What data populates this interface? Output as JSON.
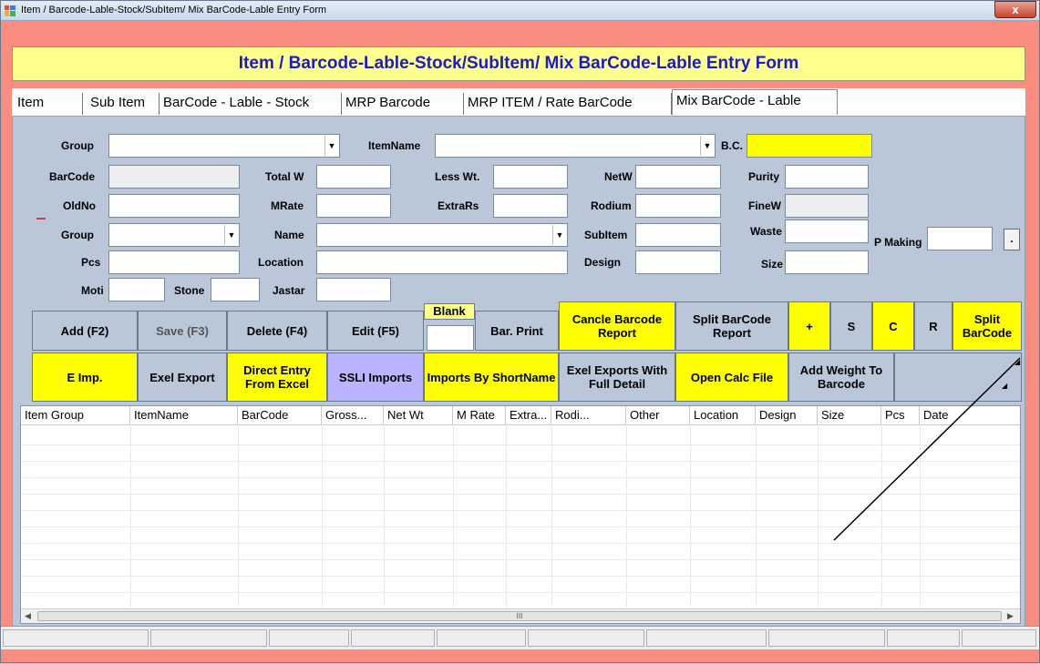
{
  "window": {
    "title": "Item / Barcode-Lable-Stock/SubItem/ Mix BarCode-Lable Entry Form",
    "close_label": "x"
  },
  "header": {
    "title": "Item / Barcode-Lable-Stock/SubItem/ Mix BarCode-Lable Entry Form"
  },
  "tabs": [
    "Item",
    "Sub Item",
    "BarCode - Lable - Stock",
    "MRP Barcode",
    "MRP ITEM / Rate BarCode",
    "Mix BarCode - Lable"
  ],
  "form": {
    "group": "Group",
    "itemname": "ItemName",
    "bc": "B.C.",
    "barcode": "BarCode",
    "total_w": "Total W",
    "less_wt": "Less Wt.",
    "netw": "NetW",
    "purity": "Purity",
    "oldno": "OldNo",
    "mrate": "MRate",
    "extrars": "ExtraRs",
    "rodium": "Rodium",
    "finew": "FineW",
    "group2": "Group",
    "name": "Name",
    "subitem": "SubItem",
    "waste": "Waste",
    "p_making": "P Making",
    "pcs": "Pcs",
    "location": "Location",
    "design": "Design",
    "size": "Size",
    "moti": "Moti",
    "stone": "Stone",
    "jastar": "Jastar",
    "small_button": "."
  },
  "buttons_row1": {
    "add": "Add (F2)",
    "save": "Save (F3)",
    "delete": "Delete (F4)",
    "edit": "Edit (F5)",
    "blank": "Blank",
    "bar_print": "Bar. Print",
    "cancle_report": "Cancle Barcode Report",
    "split_report": "Split BarCode Report",
    "plus": "+",
    "s": "S",
    "c": "C",
    "r": "R",
    "split_barcode": "Split BarCode"
  },
  "buttons_row2": {
    "e_imp": "E Imp.",
    "exel_export": "Exel Export",
    "direct_entry": "Direct Entry From Excel",
    "ssli_imports": "SSLI Imports",
    "imports_shortname": "Imports By ShortName",
    "exel_full": "Exel Exports With Full Detail",
    "open_calc": "Open Calc File",
    "add_weight": "Add Weight To Barcode"
  },
  "grid": {
    "columns": [
      "Item Group",
      "ItemName",
      "BarCode",
      "Gross...",
      "Net Wt",
      "M Rate",
      "Extra...",
      "Rodi...",
      "Other",
      "Location",
      "Design",
      "Size",
      "Pcs",
      "Date"
    ],
    "scroll_grip": "III"
  },
  "colors": {
    "window_frame": "#fa8d80",
    "panel": "#b9c7d8",
    "header_bg": "#ffff8c",
    "header_text": "#1a1ad6",
    "highlight_button": "#ffff00",
    "import_button": "#bab3ff"
  }
}
